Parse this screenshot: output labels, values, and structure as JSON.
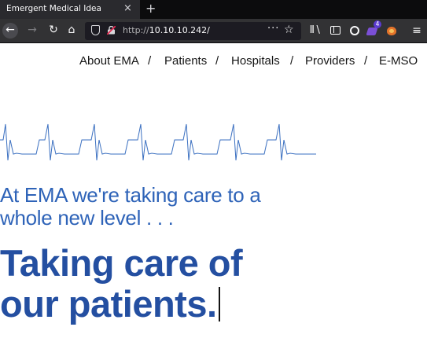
{
  "browser": {
    "tab_title": "Emergent Medical Idea",
    "tab_close": "×",
    "new_tab": "+",
    "url_protocol": "http://",
    "url_host": "10.10.10.242/",
    "url_more": "···",
    "bookmark_star": "☆",
    "menu": "≡",
    "extension_badge": "4",
    "icons": [
      "back-icon",
      "forward-icon",
      "reload-icon",
      "home-icon",
      "shield-icon",
      "insecure-lock-icon",
      "library-icon",
      "sidebar-icon",
      "account-icon",
      "extension-icon",
      "extension-icon",
      "menu-icon"
    ]
  },
  "site": {
    "nav": {
      "items": [
        "About EMA",
        "Patients",
        "Hospitals",
        "Providers",
        "E-MSO"
      ],
      "separator": "/"
    },
    "tagline": {
      "line1": "At EMA we're taking care to a",
      "line2": "whole new level . . ."
    },
    "headline": {
      "line1": "Taking care of",
      "line2": "our patients."
    },
    "colors": {
      "tagline": "#2e63b8",
      "headline": "#244fa1",
      "ecg": "#3a6fc0"
    }
  }
}
